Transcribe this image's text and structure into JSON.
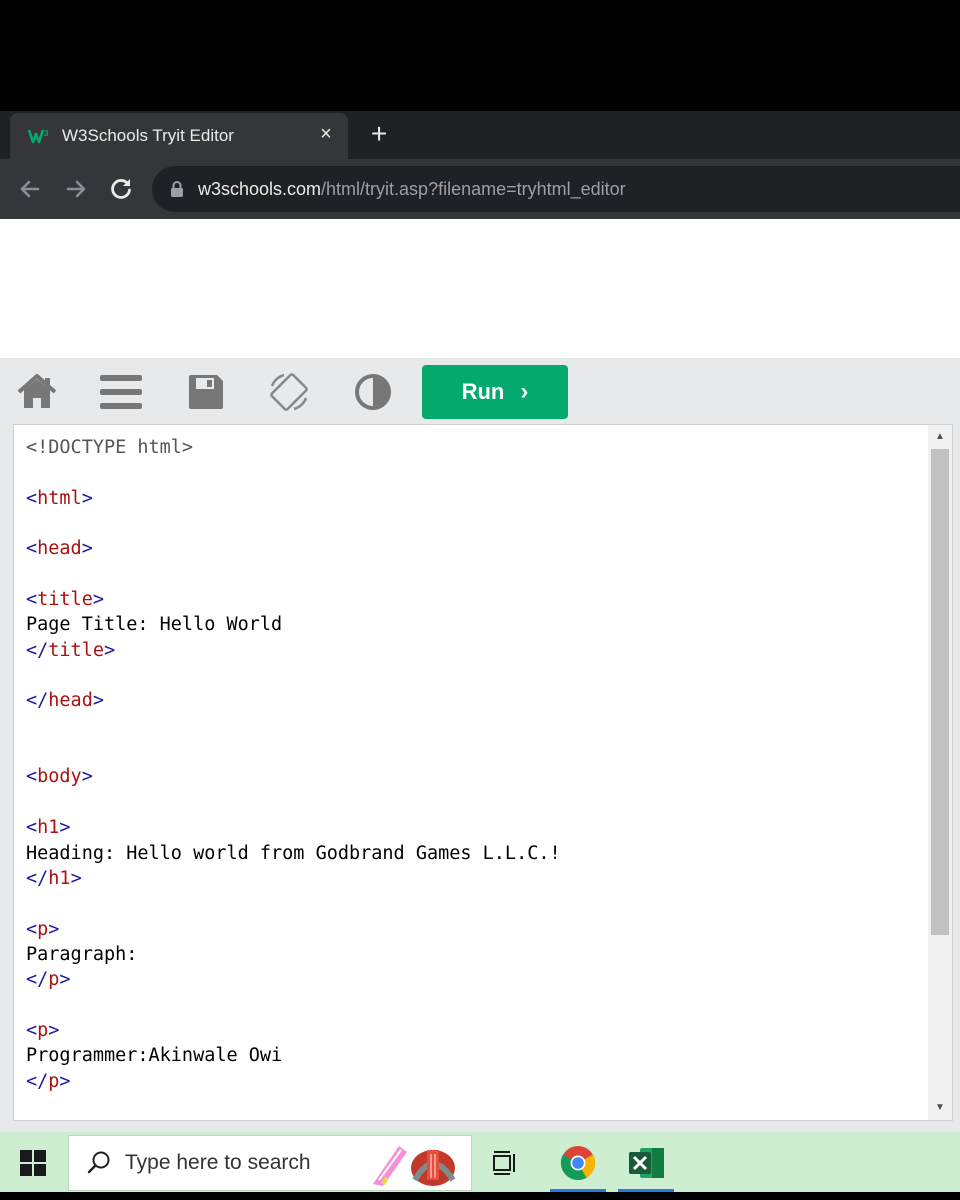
{
  "browser": {
    "tab_title": "W3Schools Tryit Editor",
    "tab_close_glyph": "×",
    "new_tab_glyph": "+",
    "url_host": "w3schools.com",
    "url_path": "/html/tryit.asp?filename=tryhtml_editor"
  },
  "tryit": {
    "run_label": "Run",
    "run_chevron": "›",
    "icons": [
      "home-icon",
      "menu-icon",
      "save-icon",
      "rotate-icon",
      "contrast-icon"
    ],
    "accent": "#04aa6d"
  },
  "editor": {
    "lines": [
      {
        "kind": "doctype",
        "text": "<!DOCTYPE html>"
      },
      {
        "kind": "blank",
        "text": ""
      },
      {
        "kind": "tag",
        "text": "<html>"
      },
      {
        "kind": "blank",
        "text": ""
      },
      {
        "kind": "tag",
        "text": "<head>"
      },
      {
        "kind": "blank",
        "text": ""
      },
      {
        "kind": "tag",
        "text": "<title>"
      },
      {
        "kind": "text",
        "text": "Page Title: Hello World"
      },
      {
        "kind": "tag",
        "text": "</title>"
      },
      {
        "kind": "blank",
        "text": ""
      },
      {
        "kind": "tag",
        "text": "</head>"
      },
      {
        "kind": "blank",
        "text": ""
      },
      {
        "kind": "blank",
        "text": ""
      },
      {
        "kind": "tag",
        "text": "<body>"
      },
      {
        "kind": "blank",
        "text": ""
      },
      {
        "kind": "tag",
        "text": "<h1>"
      },
      {
        "kind": "text",
        "text": "Heading: Hello world from Godbrand Games L.L.C.!"
      },
      {
        "kind": "tag",
        "text": "</h1>"
      },
      {
        "kind": "blank",
        "text": ""
      },
      {
        "kind": "tag",
        "text": "<p>"
      },
      {
        "kind": "text",
        "text": "Paragraph:"
      },
      {
        "kind": "tag",
        "text": "</p>"
      },
      {
        "kind": "blank",
        "text": ""
      },
      {
        "kind": "tag",
        "text": "<p>"
      },
      {
        "kind": "text",
        "text": "Programmer:Akinwale Owi"
      },
      {
        "kind": "tag",
        "text": "</p>"
      }
    ]
  },
  "taskbar": {
    "search_placeholder": "Type here to search",
    "apps": [
      "chrome-icon",
      "excel-icon"
    ]
  }
}
